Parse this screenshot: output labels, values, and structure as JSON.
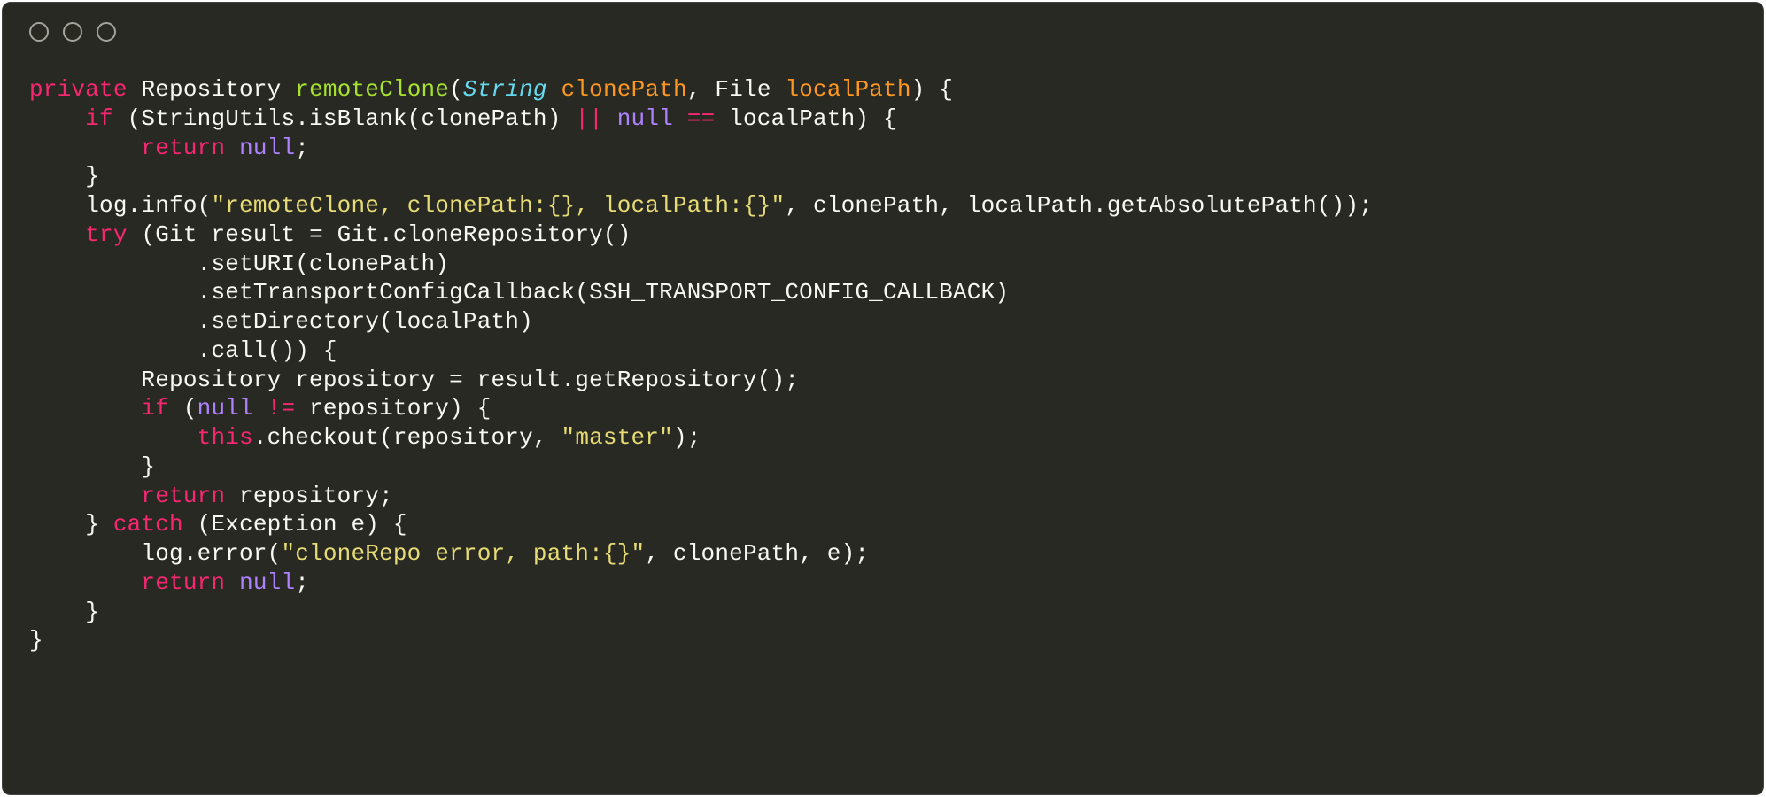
{
  "code": {
    "line1": {
      "kw_private": "private",
      "type_repository": "Repository",
      "method": "remoteClone",
      "type_string": "String",
      "param1": "clonePath",
      "type_file": "File",
      "param2": "localPath",
      "tail": ") {"
    },
    "line2": {
      "indent": "    ",
      "kw_if": "if",
      "pre": " (StringUtils.isBlank(clonePath) ",
      "op_or": "||",
      "mid": " ",
      "kw_null": "null",
      "sp2": " ",
      "op_eq": "==",
      "tail": " localPath) {"
    },
    "line3": {
      "indent": "        ",
      "kw_return": "return",
      "sp": " ",
      "kw_null": "null",
      "semi": ";"
    },
    "line4": {
      "indent": "    ",
      "brace": "}"
    },
    "line5": {
      "indent": "    ",
      "pre": "log.info(",
      "str": "\"remoteClone, clonePath:{}, localPath:{}\"",
      "tail": ", clonePath, localPath.getAbsolutePath());"
    },
    "line6": {
      "indent": "    ",
      "kw_try": "try",
      "tail": " (Git result = Git.cloneRepository()"
    },
    "line7": {
      "indent": "            ",
      "txt": ".setURI(clonePath)"
    },
    "line8": {
      "indent": "            ",
      "txt": ".setTransportConfigCallback(SSH_TRANSPORT_CONFIG_CALLBACK)"
    },
    "line9": {
      "indent": "            ",
      "txt": ".setDirectory(localPath)"
    },
    "line10": {
      "indent": "            ",
      "txt": ".call()) {"
    },
    "line11": {
      "indent": "        ",
      "txt": "Repository repository = result.getRepository();"
    },
    "line12": {
      "indent": "        ",
      "kw_if": "if",
      "pre": " (",
      "kw_null": "null",
      "sp": " ",
      "op_ne": "!=",
      "tail": " repository) {"
    },
    "line13": {
      "indent": "            ",
      "kw_this": "this",
      "pre": ".checkout(repository, ",
      "str": "\"master\"",
      "tail": ");"
    },
    "line14": {
      "indent": "        ",
      "brace": "}"
    },
    "line15": {
      "indent": "        ",
      "kw_return": "return",
      "tail": " repository;"
    },
    "line16": {
      "indent": "    ",
      "brace_close": "}",
      "sp": " ",
      "kw_catch": "catch",
      "tail": " (Exception e) {"
    },
    "line17": {
      "indent": "        ",
      "pre": "log.error(",
      "str": "\"cloneRepo error, path:{}\"",
      "tail": ", clonePath, e);"
    },
    "line18": {
      "indent": "        ",
      "kw_return": "return",
      "sp": " ",
      "kw_null": "null",
      "semi": ";"
    },
    "line19": {
      "indent": "    ",
      "brace": "}"
    },
    "line20": {
      "brace": "}"
    }
  }
}
